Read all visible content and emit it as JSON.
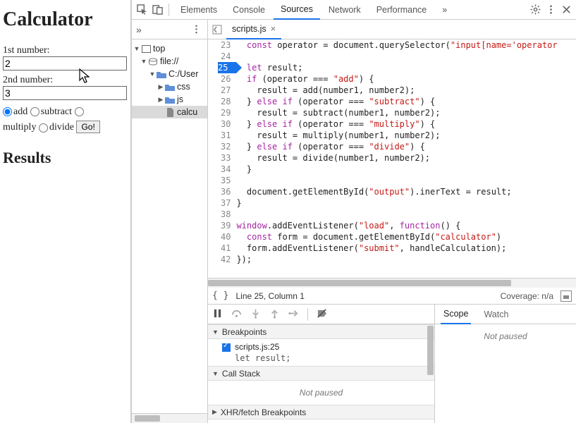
{
  "page": {
    "title": "Calculator",
    "label1": "1st number:",
    "value1": "2",
    "label2": "2nd number:",
    "value2": "3",
    "op_add": "add",
    "op_sub": "subtract",
    "op_mul": "multiply",
    "op_div": "divide",
    "go": "Go!",
    "results_heading": "Results"
  },
  "toolbar": {
    "tabs": [
      "Elements",
      "Console",
      "Sources",
      "Network",
      "Performance"
    ],
    "more": "»"
  },
  "navigator": {
    "more": "»",
    "tree": {
      "top": "top",
      "file": "file://",
      "root": "C:/User",
      "css": "css",
      "js": "js",
      "calcu": "calcu"
    }
  },
  "fileTabs": {
    "name": "scripts.js"
  },
  "editor": {
    "firstLine": 23,
    "breakpointLine": 25,
    "lines": [
      {
        "n": 23,
        "t": "  const operator = document.querySelector(\"input[name='operator"
      },
      {
        "n": 24,
        "t": ""
      },
      {
        "n": 25,
        "t": "  let result;"
      },
      {
        "n": 26,
        "t": "  if (operator === \"add\") {"
      },
      {
        "n": 27,
        "t": "    result = add(number1, number2);"
      },
      {
        "n": 28,
        "t": "  } else if (operator === \"subtract\") {"
      },
      {
        "n": 29,
        "t": "    result = subtract(number1, number2);"
      },
      {
        "n": 30,
        "t": "  } else if (operator === \"multiply\") {"
      },
      {
        "n": 31,
        "t": "    result = multiply(number1, number2);"
      },
      {
        "n": 32,
        "t": "  } else if (operator === \"divide\") {"
      },
      {
        "n": 33,
        "t": "    result = divide(number1, number2);"
      },
      {
        "n": 34,
        "t": "  }"
      },
      {
        "n": 35,
        "t": ""
      },
      {
        "n": 36,
        "t": "  document.getElementById(\"output\").inerText = result;"
      },
      {
        "n": 37,
        "t": "}"
      },
      {
        "n": 38,
        "t": ""
      },
      {
        "n": 39,
        "t": "window.addEventListener(\"load\", function() {"
      },
      {
        "n": 40,
        "t": "  const form = document.getElementById(\"calculator\")"
      },
      {
        "n": 41,
        "t": "  form.addEventListener(\"submit\", handleCalculation);"
      },
      {
        "n": 42,
        "t": "});"
      }
    ]
  },
  "status": {
    "pos": "Line 25, Column 1",
    "coverage": "Coverage: n/a"
  },
  "debug": {
    "breakpoints_head": "Breakpoints",
    "bp_label": "scripts.js:25",
    "bp_code": "let result;",
    "callstack_head": "Call Stack",
    "not_paused": "Not paused",
    "xhr_head": "XHR/fetch Breakpoints",
    "scope_tab": "Scope",
    "watch_tab": "Watch"
  }
}
